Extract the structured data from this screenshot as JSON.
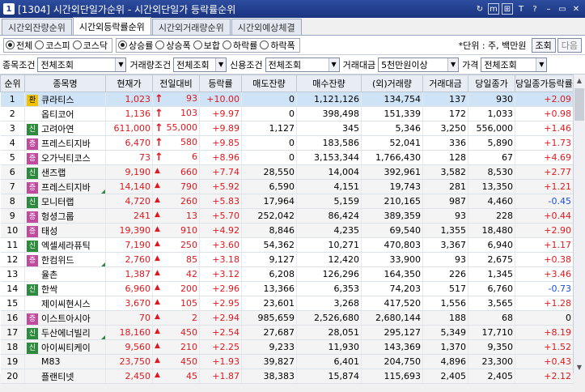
{
  "titlebar": {
    "number": "1",
    "title": "[1304] 시간외단일가순위 - 시간외단일가 등락률순위",
    "icons": [
      "link-icon",
      "m-icon",
      "window-icon",
      "font-icon",
      "help-icon",
      "dash-icon",
      "restore-icon",
      "close-icon"
    ],
    "icon_glyphs": [
      "↻",
      "m",
      "⊞",
      "T",
      "?",
      "–",
      "▭",
      "✕"
    ]
  },
  "tabs": [
    {
      "label": "시간외잔량순위",
      "active": false
    },
    {
      "label": "시간외등락률순위",
      "active": true
    },
    {
      "label": "시간외거래량순위",
      "active": false
    },
    {
      "label": "시간외예상체결",
      "active": false
    }
  ],
  "options": {
    "market": [
      {
        "label": "전체",
        "on": true
      },
      {
        "label": "코스피",
        "on": false
      },
      {
        "label": "코스닥",
        "on": false
      }
    ],
    "direction": [
      {
        "label": "상승률",
        "on": true
      },
      {
        "label": "상승폭",
        "on": false
      },
      {
        "label": "보합",
        "on": false
      },
      {
        "label": "하락률",
        "on": false
      },
      {
        "label": "하락폭",
        "on": false
      }
    ],
    "unit": "*단위 : 주, 백만원",
    "query_button": "조회",
    "next_button": "다음"
  },
  "filters": [
    {
      "label": "종목조건",
      "value": "전체조회"
    },
    {
      "label": "거래량조건",
      "value": "전체조회"
    },
    {
      "label": "신용조건",
      "value": "전체조회"
    },
    {
      "label": "거래대금",
      "value": "5천만원이상"
    },
    {
      "label": "가격",
      "value": "전체조회"
    }
  ],
  "table": {
    "headers": [
      "순위",
      "종목명",
      "현재가",
      "전일대비",
      "등락률",
      "매도잔량",
      "매수잔량",
      "(외)거래량",
      "거래대금",
      "당일종가",
      "당일종가등락률"
    ],
    "colors": {
      "red": "#e0181e",
      "blue": "#1a4fd8"
    },
    "badge_colors": {
      "환": "#f2c200",
      "신": "#2e8a3e",
      "증": "#c04a9e"
    },
    "rows": [
      {
        "rank": "1",
        "badge": "환",
        "name": "큐라티스",
        "price": "1,023",
        "change": "93",
        "mark": "↑",
        "rate": "+10.00",
        "sell": "0",
        "buy": "1,121,126",
        "volume": "134,754",
        "amount": "137",
        "close": "930",
        "close_rate": "+2.09",
        "corner": false,
        "close_color": "red"
      },
      {
        "rank": "2",
        "badge": "",
        "name": "옵티코어",
        "price": "1,136",
        "change": "103",
        "mark": "↑",
        "rate": "+9.97",
        "sell": "0",
        "buy": "398,498",
        "volume": "151,339",
        "amount": "172",
        "close": "1,033",
        "close_rate": "+0.98",
        "corner": false,
        "close_color": "red"
      },
      {
        "rank": "3",
        "badge": "신",
        "name": "고려아연",
        "price": "611,000",
        "change": "55,000",
        "mark": "↑",
        "rate": "+9.89",
        "sell": "1,127",
        "buy": "345",
        "volume": "5,346",
        "amount": "3,250",
        "close": "556,000",
        "close_rate": "+1.46",
        "corner": false,
        "close_color": "red"
      },
      {
        "rank": "4",
        "badge": "증",
        "name": "프레스티지바",
        "price": "6,470",
        "change": "580",
        "mark": "↑",
        "rate": "+9.85",
        "sell": "0",
        "buy": "183,586",
        "volume": "52,041",
        "amount": "336",
        "close": "5,890",
        "close_rate": "+1.73",
        "corner": false,
        "close_color": "red"
      },
      {
        "rank": "5",
        "badge": "증",
        "name": "오가닉티코스",
        "price": "73",
        "change": "6",
        "mark": "↑",
        "rate": "+8.96",
        "sell": "0",
        "buy": "3,153,344",
        "volume": "1,766,430",
        "amount": "128",
        "close": "67",
        "close_rate": "+4.69",
        "corner": false,
        "close_color": "red"
      },
      {
        "rank": "6",
        "badge": "신",
        "name": "샌즈랩",
        "price": "9,190",
        "change": "660",
        "mark": "▲",
        "rate": "+7.74",
        "sell": "28,550",
        "buy": "14,004",
        "volume": "392,961",
        "amount": "3,582",
        "close": "8,530",
        "close_rate": "+2.77",
        "corner": false,
        "close_color": "red"
      },
      {
        "rank": "7",
        "badge": "증",
        "name": "프레스티지바",
        "price": "14,140",
        "change": "790",
        "mark": "▲",
        "rate": "+5.92",
        "sell": "6,590",
        "buy": "4,151",
        "volume": "19,743",
        "amount": "281",
        "close": "13,350",
        "close_rate": "+1.21",
        "corner": true,
        "close_color": "red"
      },
      {
        "rank": "8",
        "badge": "신",
        "name": "모니터랩",
        "price": "4,720",
        "change": "260",
        "mark": "▲",
        "rate": "+5.83",
        "sell": "17,964",
        "buy": "5,159",
        "volume": "210,165",
        "amount": "987",
        "close": "4,460",
        "close_rate": "-0.45",
        "corner": false,
        "close_color": "blue"
      },
      {
        "rank": "9",
        "badge": "증",
        "name": "헝셩그룹",
        "price": "241",
        "change": "13",
        "mark": "▲",
        "rate": "+5.70",
        "sell": "252,042",
        "buy": "86,424",
        "volume": "389,359",
        "amount": "93",
        "close": "228",
        "close_rate": "+0.44",
        "corner": false,
        "close_color": "red"
      },
      {
        "rank": "10",
        "badge": "증",
        "name": "태성",
        "price": "19,390",
        "change": "910",
        "mark": "▲",
        "rate": "+4.92",
        "sell": "8,846",
        "buy": "4,235",
        "volume": "69,540",
        "amount": "1,355",
        "close": "18,480",
        "close_rate": "+2.90",
        "corner": false,
        "close_color": "red"
      },
      {
        "rank": "11",
        "badge": "신",
        "name": "엑셀세라퓨틱",
        "price": "7,190",
        "change": "250",
        "mark": "▲",
        "rate": "+3.60",
        "sell": "54,362",
        "buy": "10,271",
        "volume": "470,803",
        "amount": "3,367",
        "close": "6,940",
        "close_rate": "+1.17",
        "corner": false,
        "close_color": "red"
      },
      {
        "rank": "12",
        "badge": "증",
        "name": "한컴위드",
        "price": "2,760",
        "change": "85",
        "mark": "▲",
        "rate": "+3.18",
        "sell": "9,127",
        "buy": "12,420",
        "volume": "33,900",
        "amount": "93",
        "close": "2,675",
        "close_rate": "+0.38",
        "corner": true,
        "close_color": "red"
      },
      {
        "rank": "13",
        "badge": "",
        "name": "율촌",
        "price": "1,387",
        "change": "42",
        "mark": "▲",
        "rate": "+3.12",
        "sell": "6,208",
        "buy": "126,296",
        "volume": "164,350",
        "amount": "226",
        "close": "1,345",
        "close_rate": "+3.46",
        "corner": false,
        "close_color": "red"
      },
      {
        "rank": "14",
        "badge": "신",
        "name": "한싹",
        "price": "6,960",
        "change": "200",
        "mark": "▲",
        "rate": "+2.96",
        "sell": "13,366",
        "buy": "6,353",
        "volume": "74,203",
        "amount": "517",
        "close": "6,760",
        "close_rate": "-0.73",
        "corner": false,
        "close_color": "blue"
      },
      {
        "rank": "15",
        "badge": "",
        "name": "제이씨현시스",
        "price": "3,670",
        "change": "105",
        "mark": "▲",
        "rate": "+2.95",
        "sell": "23,601",
        "buy": "3,268",
        "volume": "417,520",
        "amount": "1,556",
        "close": "3,565",
        "close_rate": "+1.28",
        "corner": false,
        "close_color": "red"
      },
      {
        "rank": "16",
        "badge": "증",
        "name": "이스트아시아",
        "price": "70",
        "change": "2",
        "mark": "▲",
        "rate": "+2.94",
        "sell": "985,659",
        "buy": "2,526,680",
        "volume": "2,680,144",
        "amount": "188",
        "close": "68",
        "close_rate": "0",
        "corner": false,
        "close_color": "black"
      },
      {
        "rank": "17",
        "badge": "신",
        "name": "두산에너빌리",
        "price": "18,160",
        "change": "450",
        "mark": "▲",
        "rate": "+2.54",
        "sell": "27,687",
        "buy": "28,051",
        "volume": "295,127",
        "amount": "5,349",
        "close": "17,710",
        "close_rate": "+8.19",
        "corner": true,
        "close_color": "red"
      },
      {
        "rank": "18",
        "badge": "신",
        "name": "아이씨티케이",
        "price": "9,560",
        "change": "210",
        "mark": "▲",
        "rate": "+2.25",
        "sell": "9,233",
        "buy": "11,930",
        "volume": "143,369",
        "amount": "1,370",
        "close": "9,350",
        "close_rate": "+1.52",
        "corner": false,
        "close_color": "red"
      },
      {
        "rank": "19",
        "badge": "",
        "name": "M83",
        "price": "23,750",
        "change": "450",
        "mark": "▲",
        "rate": "+1.93",
        "sell": "39,827",
        "buy": "6,401",
        "volume": "204,750",
        "amount": "4,896",
        "close": "23,300",
        "close_rate": "+0.43",
        "corner": false,
        "close_color": "red"
      },
      {
        "rank": "20",
        "badge": "",
        "name": "플랜티넷",
        "price": "2,450",
        "change": "45",
        "mark": "▲",
        "rate": "+1.87",
        "sell": "38,383",
        "buy": "15,874",
        "volume": "115,693",
        "amount": "2,405",
        "close": "2,405",
        "close_rate": "+2.12",
        "corner": false,
        "close_color": "red"
      }
    ]
  }
}
